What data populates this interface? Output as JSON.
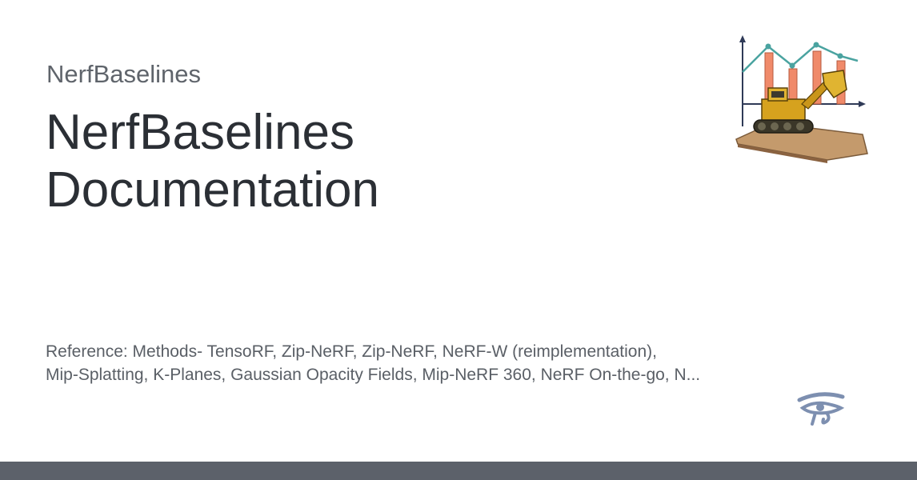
{
  "site": {
    "name": "NerfBaselines"
  },
  "title": {
    "line1": "NerfBaselines",
    "line2": "Documentation"
  },
  "description": {
    "line1": "Reference: Methods- TensoRF, Zip-NeRF, Zip-NeRF, NeRF-W (reimplementation),",
    "line2": "Mip-Splatting, K-Planes, Gaussian Opacity Fields, Mip-NeRF 360, NeRF On-the-go, N..."
  },
  "icons": {
    "logo": "chart-bulldozer-logo-icon",
    "eye": "eye-of-horus-icon"
  },
  "colors": {
    "title": "#2b2f35",
    "site_name": "#5f646b",
    "description": "#5a5f66",
    "footer_bar": "#5c616a",
    "chart_line": "#4aa3a0",
    "chart_bars": "#f08a6a",
    "eye_icon": "#7d8fb0"
  }
}
